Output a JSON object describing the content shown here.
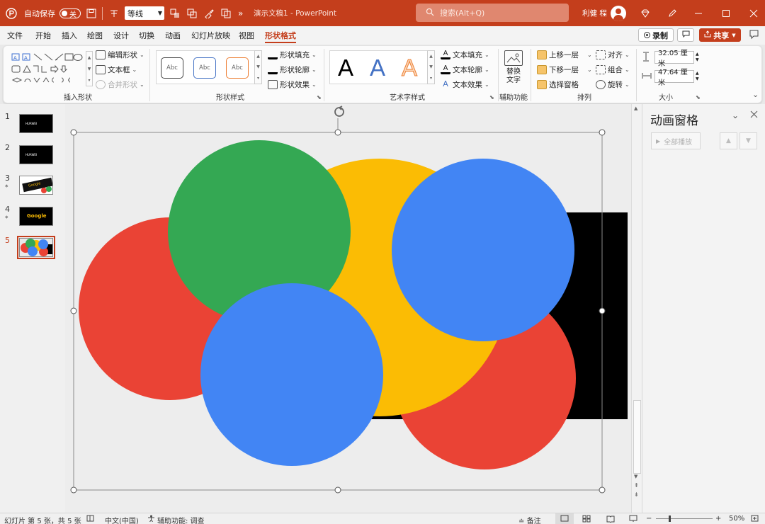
{
  "titlebar": {
    "autosave_label": "自动保存",
    "autosave_state": "关",
    "font_name": "等线",
    "doc_title": "演示文稿1",
    "separator": "-",
    "app_name": "PowerPoint",
    "search_placeholder": "搜索(Alt+Q)",
    "user_name": "利健 程",
    "more_glyph": "»"
  },
  "menu": {
    "tabs": [
      "文件",
      "开始",
      "插入",
      "绘图",
      "设计",
      "切换",
      "动画",
      "幻灯片放映",
      "视图",
      "形状格式"
    ],
    "active_tab": "形状格式",
    "record_label": "录制",
    "share_label": "共享"
  },
  "ribbon": {
    "insert_shapes": {
      "label": "插入形状",
      "edit_shape": "编辑形状",
      "text_box": "文本框",
      "merge_shapes": "合并形状"
    },
    "shape_styles": {
      "label": "形状样式",
      "presets": [
        "Abc",
        "Abc",
        "Abc"
      ],
      "fill": "形状填充",
      "outline": "形状轮廓",
      "effects": "形状效果"
    },
    "wordart": {
      "label": "艺术字样式",
      "letters": [
        "A",
        "A",
        "A"
      ],
      "text_fill": "文本填充",
      "text_outline": "文本轮廓",
      "text_effects": "文本效果"
    },
    "accessibility": {
      "label": "辅助功能",
      "alt_text_line1": "替换",
      "alt_text_line2": "文字"
    },
    "arrange": {
      "label": "排列",
      "bring_forward": "上移一层",
      "send_backward": "下移一层",
      "selection_pane": "选择窗格",
      "align": "对齐",
      "group": "组合",
      "rotate": "旋转"
    },
    "size": {
      "label": "大小",
      "height": "32.05 厘米",
      "width": "47.64 厘米"
    }
  },
  "thumbnails": [
    {
      "number": "1",
      "star": "",
      "text": "HUAWEI"
    },
    {
      "number": "2",
      "star": "",
      "text": "HUAWEI"
    },
    {
      "number": "3",
      "star": "*",
      "text": "Google"
    },
    {
      "number": "4",
      "star": "*",
      "text": "Google"
    },
    {
      "number": "5",
      "star": "",
      "text": ""
    }
  ],
  "active_slide": "5",
  "colors": {
    "accent": "#c43e1c",
    "red": "#ea4335",
    "green": "#34a853",
    "yellow": "#fbbc04",
    "blue": "#4285f4",
    "black": "#000000"
  },
  "animation_pane": {
    "title": "动画窗格",
    "play_all": "全部播放"
  },
  "statusbar": {
    "slide_info": "幻灯片 第 5 张，共 5 张",
    "language": "中文(中国)",
    "accessibility": "辅助功能: 调查",
    "notes": "备注",
    "zoom": "50%"
  }
}
